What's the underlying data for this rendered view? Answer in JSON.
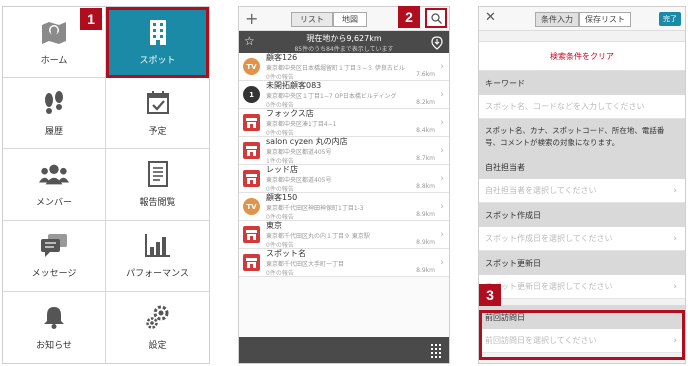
{
  "badges": [
    "1",
    "2",
    "3"
  ],
  "menu": {
    "items": [
      {
        "label": "ホーム",
        "icon": "map-pin-icon"
      },
      {
        "label": "スポット",
        "icon": "building-icon",
        "active": true
      },
      {
        "label": "履歴",
        "icon": "footprints-icon"
      },
      {
        "label": "予定",
        "icon": "calendar-icon"
      },
      {
        "label": "メンバー",
        "icon": "people-icon"
      },
      {
        "label": "報告閲覧",
        "icon": "document-icon"
      },
      {
        "label": "メッセージ",
        "icon": "chat-icon"
      },
      {
        "label": "パフォーマンス",
        "icon": "bar-chart-icon"
      },
      {
        "label": "お知らせ",
        "icon": "bell-icon"
      },
      {
        "label": "設定",
        "icon": "gear-icon"
      }
    ]
  },
  "list": {
    "plus": "+",
    "tabs": [
      "リスト",
      "地図"
    ],
    "header_main": "現在地から9,627km",
    "header_sub": "85件のうち84件まで表示しています",
    "rows": [
      {
        "icon_text": "TV",
        "icon_color": "#e0944a",
        "name": "顧客126",
        "address": "東京都中央区日本橋堀留町１丁目３−３ 伊良古ビル",
        "report": "0件の報告",
        "dist": "7.6km"
      },
      {
        "icon_text": "1",
        "icon_color": "#333333",
        "name": "未開拓顧客083",
        "address": "東京都中央区１丁目1−7 OP日本橋ビルディング",
        "report": "0件の報告",
        "dist": "8.2km"
      },
      {
        "icon_text": "",
        "icon_color": "#d23a3a",
        "name": "フォックス店",
        "address": "東京都中央区湊1丁目4−1",
        "report": "0件の報告",
        "dist": "8.4km"
      },
      {
        "icon_text": "",
        "icon_color": "#d23a3a",
        "name": "salon cyzen 丸の内店",
        "address": "東京都中央区都道405号",
        "report": "1件の報告",
        "dist": "8.7km"
      },
      {
        "icon_text": "",
        "icon_color": "#d23a3a",
        "name": "レッド店",
        "address": "東京都中央区都道405号",
        "report": "0件の報告",
        "dist": "8.8km"
      },
      {
        "icon_text": "TV",
        "icon_color": "#e0944a",
        "name": "顧客150",
        "address": "東京都千代田区神田神保町1丁目1-3",
        "report": "0件の報告",
        "dist": "8.9km"
      },
      {
        "icon_text": "",
        "icon_color": "#d23a3a",
        "name": "東京",
        "address": "東京都千代田区丸の内１丁目９ 東京駅",
        "report": "0件の報告",
        "dist": "8.9km"
      },
      {
        "icon_text": "",
        "icon_color": "#d23a3a",
        "name": "スポット名",
        "address": "東京都千代田区大手町一丁目",
        "report": "0件の報告",
        "dist": "8.9km"
      }
    ]
  },
  "search": {
    "tabs": [
      "条件入力",
      "保存リスト"
    ],
    "done": "完了",
    "clear": "検索条件をクリア",
    "keyword_label": "キーワード",
    "keyword_placeholder": "スポット名、コードなどを入力してください",
    "keyword_desc": "スポット名、カナ、スポットコード、所在地、電話番号、コメントが検索の対象になります。",
    "owner_label": "自社担当者",
    "owner_placeholder": "自社担当者を選択してください",
    "created_label": "スポット作成日",
    "created_placeholder": "スポット作成日を選択してください",
    "updated_label": "スポット更新日",
    "updated_placeholder": "スポット更新日を選択してください",
    "lastvisit_label": "前回訪問日",
    "lastvisit_placeholder": "前回訪問日を選択してください"
  },
  "colors": {
    "accent": "#1b8aa6",
    "highlight": "#b00d1e",
    "clear_text": "#d0021b"
  }
}
